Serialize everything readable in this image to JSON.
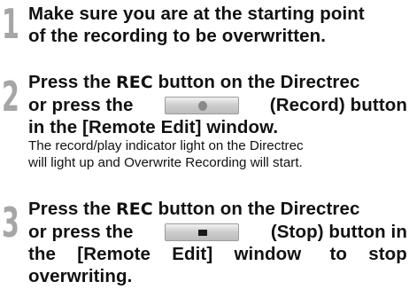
{
  "steps": [
    {
      "number": "1",
      "lines": [
        "Make sure you are at the starting point",
        "of the recording to be overwritten."
      ]
    },
    {
      "number": "2",
      "line1": {
        "a": "Press the ",
        "key": "REC",
        "b": " button on the Directrec"
      },
      "line2": {
        "a": "or press the",
        "b": "(Record) button"
      },
      "record_icon": "record-dot-icon",
      "line3": "in the [Remote Edit] window.",
      "desc": [
        "The record/play indicator light on the Directrec",
        "will light up and Overwrite Recording will start."
      ]
    },
    {
      "number": "3",
      "line1": {
        "a": "Press the ",
        "key": "REC",
        "b": " button on the Directrec"
      },
      "line2": {
        "a": "or press the",
        "b": "(Stop) button in"
      },
      "stop_icon": "stop-square-icon",
      "line3": {
        "a": "the",
        "b": "[Remote",
        "c": "Edit]",
        "d": "window",
        "e": "to",
        "f": "stop"
      },
      "line4": "overwriting."
    }
  ]
}
